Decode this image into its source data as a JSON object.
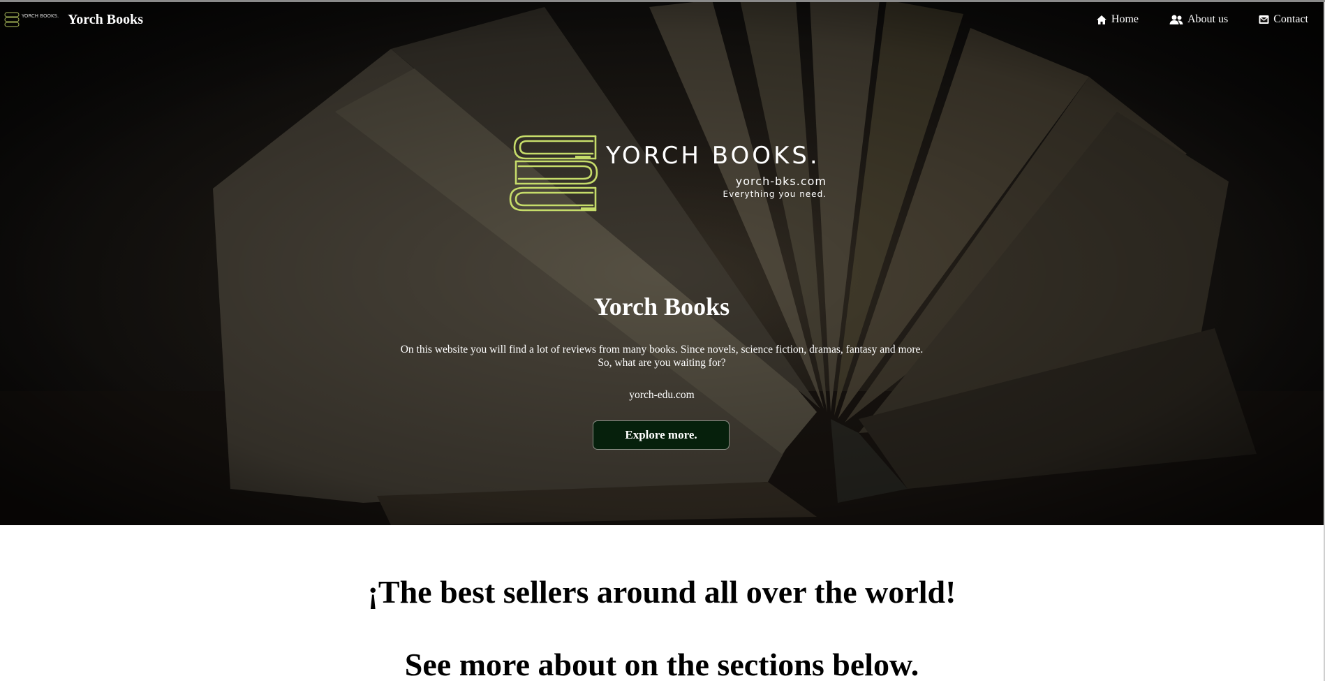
{
  "nav": {
    "brand_logo_text": "YORCH BOOKS.",
    "brand_name": "Yorch Books",
    "links": [
      {
        "label": "Home",
        "icon": "home-icon"
      },
      {
        "label": "About us",
        "icon": "users-icon"
      },
      {
        "label": "Contact",
        "icon": "envelope-icon"
      }
    ]
  },
  "logo": {
    "title": "YORCH BOOKS.",
    "domain": "yorch-bks.com",
    "tagline": "Everything you need."
  },
  "hero": {
    "title": "Yorch Books",
    "description_line1": "On this website you will find a lot of reviews from many books. Since novels, science fiction, dramas, fantasy and more.",
    "description_line2": "So, what are you waiting for?",
    "url": "yorch-edu.com",
    "button_label": "Explore more."
  },
  "content": {
    "headline": "¡The best sellers around all over the world!",
    "subheadline": "See more about on the sections below."
  },
  "colors": {
    "logo_green": "#c6dc6a",
    "button_bg": "#06200c",
    "text_light": "#ffffff"
  }
}
